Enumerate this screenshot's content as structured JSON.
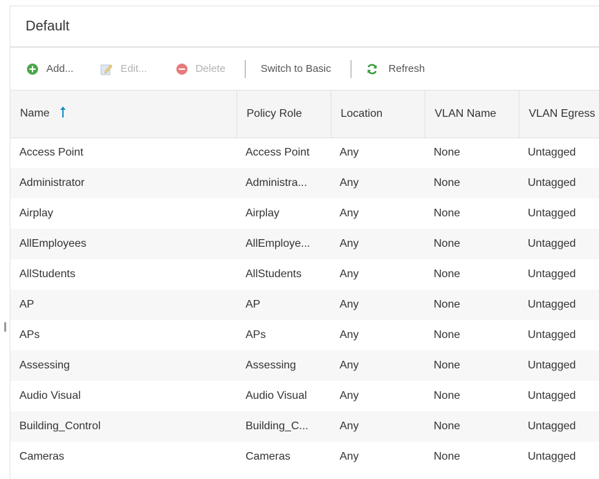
{
  "panel": {
    "title": "Default"
  },
  "toolbar": {
    "add_label": "Add...",
    "edit_label": "Edit...",
    "delete_label": "Delete",
    "switch_label": "Switch to Basic",
    "refresh_label": "Refresh"
  },
  "colors": {
    "add_icon": "#4aa64a",
    "delete_icon": "#e87a7a",
    "refresh_icon": "#3a9a3a",
    "sort_icon": "#1a8fc7"
  },
  "columns": [
    "Name",
    "Policy Role",
    "Location",
    "VLAN Name",
    "VLAN Egress"
  ],
  "rows": [
    [
      "Access Point",
      "Access Point",
      "Any",
      "None",
      "Untagged"
    ],
    [
      "Administrator",
      "Administra...",
      "Any",
      "None",
      "Untagged"
    ],
    [
      "Airplay",
      "Airplay",
      "Any",
      "None",
      "Untagged"
    ],
    [
      "AllEmployees",
      "AllEmploye...",
      "Any",
      "None",
      "Untagged"
    ],
    [
      "AllStudents",
      "AllStudents",
      "Any",
      "None",
      "Untagged"
    ],
    [
      "AP",
      "AP",
      "Any",
      "None",
      "Untagged"
    ],
    [
      "APs",
      "APs",
      "Any",
      "None",
      "Untagged"
    ],
    [
      "Assessing",
      "Assessing",
      "Any",
      "None",
      "Untagged"
    ],
    [
      "Audio Visual",
      "Audio Visual",
      "Any",
      "None",
      "Untagged"
    ],
    [
      "Building_Control",
      "Building_C...",
      "Any",
      "None",
      "Untagged"
    ],
    [
      "Cameras",
      "Cameras",
      "Any",
      "None",
      "Untagged"
    ]
  ]
}
